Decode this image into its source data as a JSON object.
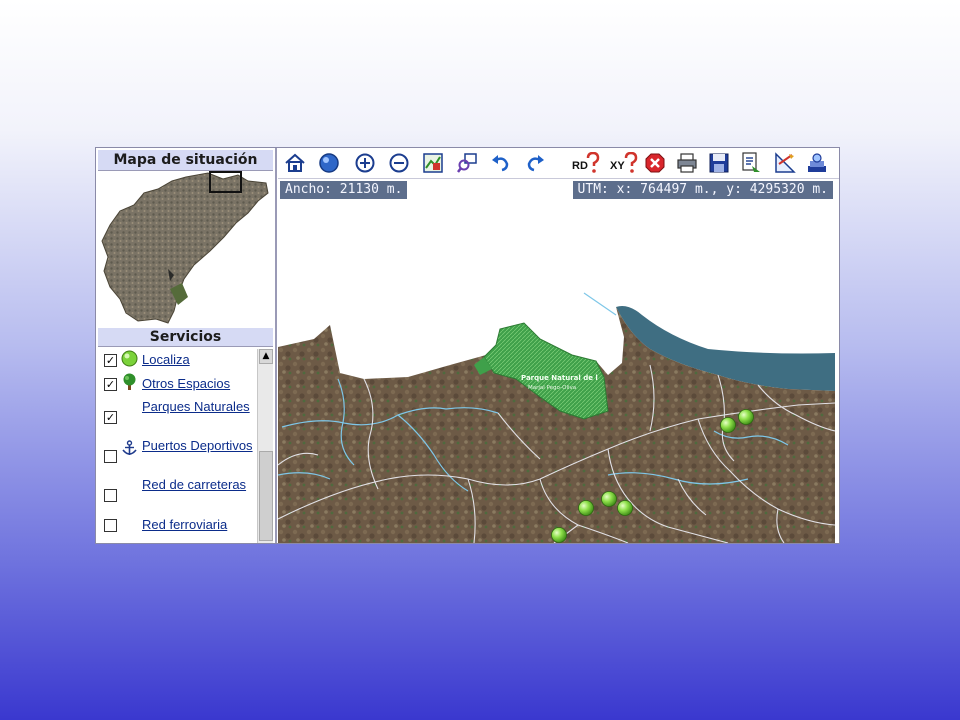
{
  "locator_panel": {
    "title": "Mapa de situación"
  },
  "services_panel": {
    "title": "Servicios",
    "items": [
      {
        "label": "Localiza",
        "checked": true,
        "icon": "green-marker-icon",
        "check_mark": "✓"
      },
      {
        "label": "Otros Espacios",
        "checked": true,
        "icon": "tree-icon",
        "check_mark": "✓"
      },
      {
        "label": "Parques Naturales",
        "checked": true,
        "icon": "",
        "check_mark": "✓"
      },
      {
        "label": "Puertos Deportivos",
        "checked": false,
        "icon": "anchor-icon",
        "check_mark": ""
      },
      {
        "label": "Red de carreteras",
        "checked": false,
        "icon": "",
        "check_mark": ""
      },
      {
        "label": "Red ferroviaria",
        "checked": false,
        "icon": "",
        "check_mark": ""
      }
    ],
    "scroll_up_glyph": "▲"
  },
  "toolbar": {
    "buttons": [
      "home-icon",
      "globe-icon",
      "zoom-in-icon",
      "zoom-out-icon",
      "zoom-extent-icon",
      "zoom-window-icon",
      "undo-icon",
      "redo-icon",
      "rd-query-icon",
      "xy-query-icon",
      "clear-icon",
      "print-icon",
      "save-icon",
      "report-icon",
      "measure-icon",
      "options-icon"
    ],
    "rd_text": "RD",
    "xy_text": "XY"
  },
  "map": {
    "width_readout": "Ancho: 21130 m.",
    "utm_readout": "UTM: x: 764497 m., y: 4295320 m.",
    "park_label_main": "Parque Natural de l",
    "park_label_sub": "Marjal Pego-Oliva",
    "marker_icon": "green-marker-icon",
    "colors": {
      "sea": "#3f6e82",
      "park": "#3fa04a",
      "terrain": "#6d5a46",
      "roads": "#e8e8ee",
      "rivers": "#7ec7e8"
    }
  },
  "colors": {
    "header_bg": "#d6daf4",
    "link": "#0b2c8a",
    "infobar_bg": "#5d6e8c"
  }
}
